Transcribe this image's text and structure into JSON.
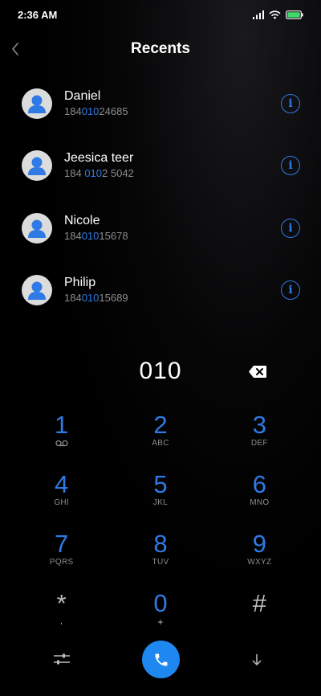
{
  "status_bar": {
    "time": "2:36 AM"
  },
  "header": {
    "title": "Recents"
  },
  "contacts": [
    {
      "name": "Daniel",
      "number_pre": "184",
      "number_match": "010",
      "number_post": "24685"
    },
    {
      "name": "Jeesica teer",
      "number_pre": "184 ",
      "number_match": "010",
      "number_post": "2 5042"
    },
    {
      "name": "Nicole",
      "number_pre": "184",
      "number_match": "010",
      "number_post": "15678"
    },
    {
      "name": "Philip",
      "number_pre": "184",
      "number_match": "010",
      "number_post": "15689"
    }
  ],
  "dialer": {
    "entered_number": "010"
  },
  "keypad": [
    {
      "digit": "1",
      "letters": ""
    },
    {
      "digit": "2",
      "letters": "ABC"
    },
    {
      "digit": "3",
      "letters": "DEF"
    },
    {
      "digit": "4",
      "letters": "GHI"
    },
    {
      "digit": "5",
      "letters": "JKL"
    },
    {
      "digit": "6",
      "letters": "MNO"
    },
    {
      "digit": "7",
      "letters": "PQRS"
    },
    {
      "digit": "8",
      "letters": "TUV"
    },
    {
      "digit": "9",
      "letters": "WXYZ"
    },
    {
      "digit": "*",
      "letters": ","
    },
    {
      "digit": "0",
      "letters": "+"
    },
    {
      "digit": "#",
      "letters": ""
    }
  ],
  "icons": {
    "back": "chevron-left-icon",
    "info": "info-icon",
    "backspace": "backspace-icon",
    "voicemail": "voicemail-icon",
    "settings": "sliders-icon",
    "call": "phone-icon",
    "collapse": "arrow-down-icon"
  },
  "colors": {
    "accent": "#2f7ae5",
    "call_button": "#1e88f0",
    "secondary_text": "#8c8c8c",
    "background": "#000000"
  }
}
